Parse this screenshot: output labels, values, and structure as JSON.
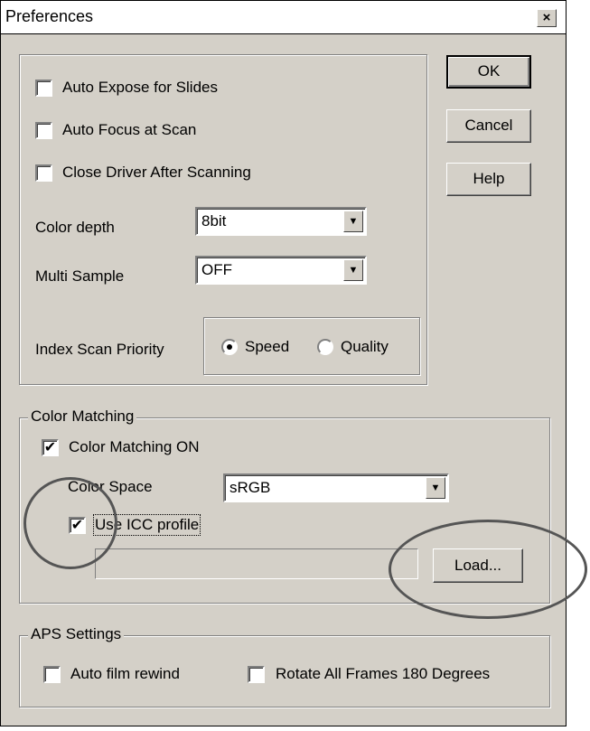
{
  "window": {
    "title": "Preferences",
    "close_glyph": "×"
  },
  "options": {
    "auto_expose": {
      "label": "Auto Expose for Slides",
      "checked": false
    },
    "auto_focus": {
      "label": "Auto Focus at Scan",
      "checked": false
    },
    "close_driver": {
      "label": "Close Driver After Scanning",
      "checked": false
    },
    "color_depth": {
      "label": "Color depth",
      "value": "8bit"
    },
    "multi_sample": {
      "label": "Multi Sample",
      "value": "OFF"
    },
    "index_scan": {
      "label": "Index Scan Priority",
      "speed": "Speed",
      "quality": "Quality",
      "selected": "Speed"
    }
  },
  "buttons": {
    "ok": "OK",
    "cancel": "Cancel",
    "help": "Help",
    "load": "Load..."
  },
  "color_matching": {
    "group_label": "Color Matching",
    "on_label": "Color Matching ON",
    "on_checked": true,
    "space_label": "Color Space",
    "space_value": "sRGB",
    "icc_label": "Use ICC profile",
    "icc_checked": true,
    "profile_path": ""
  },
  "aps": {
    "group_label": "APS Settings",
    "rewind_label": "Auto film rewind",
    "rewind_checked": false,
    "rotate_label": "Rotate All Frames 180 Degrees",
    "rotate_checked": false
  },
  "glyphs": {
    "check": "✔",
    "dropdown_arrow": "▼"
  },
  "icons": {
    "close": "close-icon",
    "dropdown": "chevron-down-icon"
  }
}
